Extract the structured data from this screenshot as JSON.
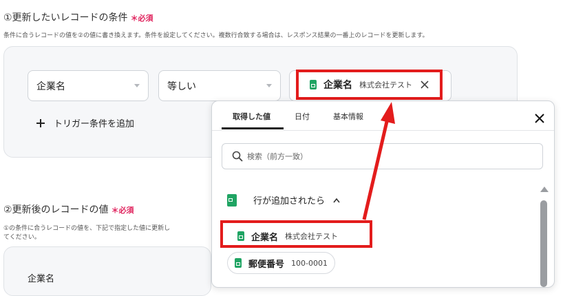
{
  "section1": {
    "title": "①更新したいレコードの条件",
    "required": "＊必須",
    "description": "条件に合うレコードの値を②の値に書き換えます。条件を設定してください。複数行合致する場合は、レスポンス結果の一番上のレコードを更新します。",
    "field_select": "企業名",
    "operator_select": "等しい",
    "value_chip": {
      "label": "企業名",
      "value": "株式会社テスト",
      "remove_icon": "close-icon"
    },
    "add_trigger": "トリガー条件を追加"
  },
  "section2": {
    "title": "②更新後のレコードの値",
    "required": "＊必須",
    "description_line1": "①の条件に合うレコードの値を、下記で指定した値に更新し",
    "description_line2": "てください。",
    "partial_field": "企業名"
  },
  "popup": {
    "tabs": [
      "取得した値",
      "日付",
      "基本情報"
    ],
    "search_placeholder": "検索（前方一致）",
    "group": {
      "label": "行が追加されたら",
      "icon": "google-sheets-icon"
    },
    "items": [
      {
        "label": "企業名",
        "value": "株式会社テスト"
      },
      {
        "label": "郵便番号",
        "value": "100-0001"
      }
    ]
  },
  "colors": {
    "required": "#e0245e",
    "highlight": "#e31c1c",
    "sheets_green": "#1fa463"
  }
}
